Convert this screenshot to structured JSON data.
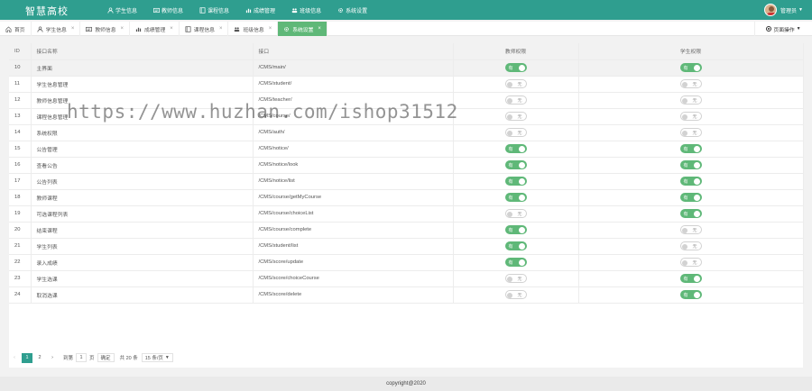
{
  "app": {
    "brand": "智慧高校"
  },
  "topnav": [
    {
      "label": "学生信息",
      "icon": "user-icon"
    },
    {
      "label": "教师信息",
      "icon": "id-card-icon"
    },
    {
      "label": "课程信息",
      "icon": "book-icon"
    },
    {
      "label": "成绩管理",
      "icon": "chart-icon"
    },
    {
      "label": "班级信息",
      "icon": "group-icon"
    },
    {
      "label": "系统设置",
      "icon": "gear-icon"
    }
  ],
  "user": {
    "name": "管理员"
  },
  "tabs": [
    {
      "label": "首页",
      "icon": "home-icon",
      "closable": false,
      "active": false
    },
    {
      "label": "学生信息",
      "icon": "user-icon",
      "closable": true,
      "active": false
    },
    {
      "label": "教师信息",
      "icon": "id-card-icon",
      "closable": true,
      "active": false
    },
    {
      "label": "成绩管理",
      "icon": "chart-icon",
      "closable": true,
      "active": false
    },
    {
      "label": "课程信息",
      "icon": "book-icon",
      "closable": true,
      "active": false
    },
    {
      "label": "班级信息",
      "icon": "group-icon",
      "closable": true,
      "active": false
    },
    {
      "label": "系统设置",
      "icon": "gear-icon",
      "closable": true,
      "active": true
    }
  ],
  "page_ops": {
    "label": "页面操作"
  },
  "table": {
    "headers": {
      "id": "ID",
      "name": "接口名称",
      "path": "接口",
      "teacher": "教师权限",
      "student": "学生权限"
    },
    "switch_on": "有",
    "switch_off": "无",
    "rows": [
      {
        "id": "10",
        "name": "主界面",
        "path": "/CMS/main/",
        "teacher": true,
        "student": true
      },
      {
        "id": "11",
        "name": "学生信息管理",
        "path": "/CMS/student/",
        "teacher": false,
        "student": false
      },
      {
        "id": "12",
        "name": "教师信息管理",
        "path": "/CMS/teacher/",
        "teacher": false,
        "student": false
      },
      {
        "id": "13",
        "name": "课程信息管理",
        "path": "/CMS/course/",
        "teacher": false,
        "student": false
      },
      {
        "id": "14",
        "name": "系统权限",
        "path": "/CMS/auth/",
        "teacher": false,
        "student": false
      },
      {
        "id": "15",
        "name": "公告管理",
        "path": "/CMS/notice/",
        "teacher": true,
        "student": true
      },
      {
        "id": "16",
        "name": "查看公告",
        "path": "/CMS/notice/look",
        "teacher": true,
        "student": true
      },
      {
        "id": "17",
        "name": "公告列表",
        "path": "/CMS/notice/list",
        "teacher": true,
        "student": true
      },
      {
        "id": "18",
        "name": "教师课程",
        "path": "/CMS/course/getMyCourse",
        "teacher": true,
        "student": true
      },
      {
        "id": "19",
        "name": "可选课程列表",
        "path": "/CMS/course/choiceList",
        "teacher": false,
        "student": true
      },
      {
        "id": "20",
        "name": "结束课程",
        "path": "/CMS/course/complete",
        "teacher": true,
        "student": false
      },
      {
        "id": "21",
        "name": "学生列表",
        "path": "/CMS/student/list",
        "teacher": true,
        "student": false
      },
      {
        "id": "22",
        "name": "录入成绩",
        "path": "/CMS/score/update",
        "teacher": true,
        "student": false
      },
      {
        "id": "23",
        "name": "学生选课",
        "path": "/CMS/score/choiceCourse",
        "teacher": false,
        "student": true
      },
      {
        "id": "24",
        "name": "取消选课",
        "path": "/CMS/score/delete",
        "teacher": false,
        "student": true
      }
    ]
  },
  "pager": {
    "pages": [
      "1",
      "2"
    ],
    "current": "1",
    "goto_label": "到第",
    "goto_value": "1",
    "page_unit": "页",
    "confirm": "确定",
    "total": "共 20 条",
    "limit": "15 条/页"
  },
  "footer": {
    "text": "copyright@2020"
  },
  "watermark": {
    "text": "https://www.huzhan.com/ishop31512"
  }
}
